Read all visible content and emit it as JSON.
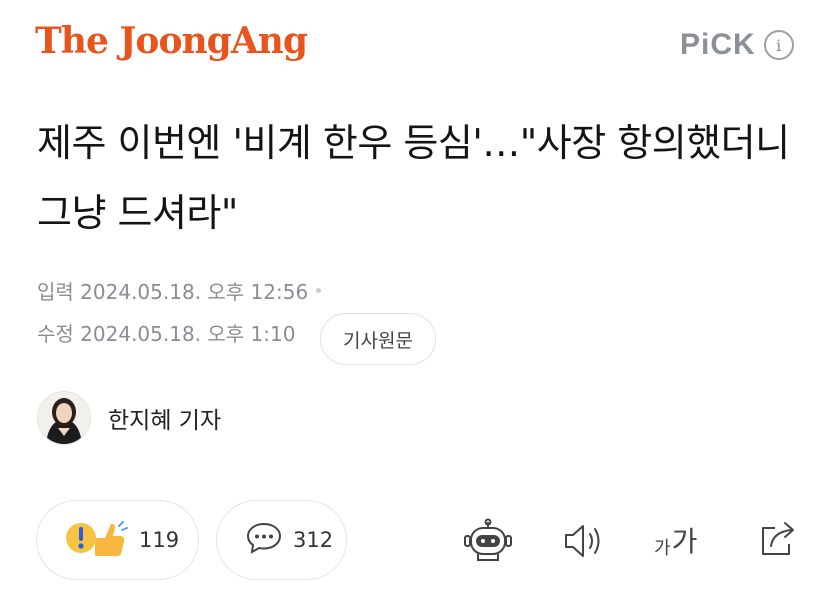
{
  "header": {
    "logo": "The JoongAng",
    "pick_label": "PiCK",
    "info_icon": "info-icon",
    "brand_color": "#e8541c"
  },
  "article": {
    "headline": "제주 이번엔 '비계 한우 등심'…\"사장 항의했더니 그냥 드셔라\"",
    "input_label": "입력",
    "input_datetime": "2024.05.18. 오후 12:56",
    "modified_label": "수정",
    "modified_datetime": "2024.05.18. 오후 1:10",
    "original_button": "기사원문"
  },
  "reporter": {
    "name": "한지혜 기자",
    "avatar_icon": "reporter-avatar"
  },
  "actions": {
    "like_count": "119",
    "comment_count": "312",
    "icons": [
      "reaction-icon",
      "comment-icon",
      "robot-summary-icon",
      "speaker-icon",
      "font-size-icon",
      "share-icon"
    ],
    "font_size_small": "가",
    "font_size_large": "가"
  }
}
